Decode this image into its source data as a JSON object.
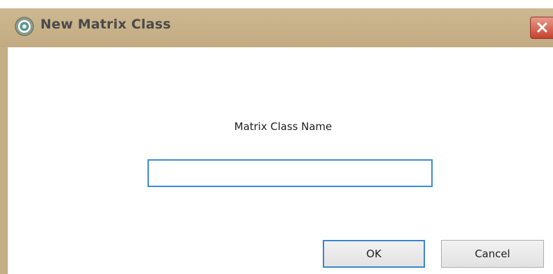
{
  "window": {
    "title": "New Matrix Class",
    "title_icon": "app-logo-icon",
    "close_icon": "close-icon"
  },
  "form": {
    "label": "Matrix Class Name",
    "input_value": "",
    "input_placeholder": ""
  },
  "buttons": {
    "ok_label": "OK",
    "cancel_label": "Cancel"
  },
  "colors": {
    "titlebar": "#c4ae86",
    "close_button": "#c8402e",
    "focus_border": "#3a85d0"
  }
}
